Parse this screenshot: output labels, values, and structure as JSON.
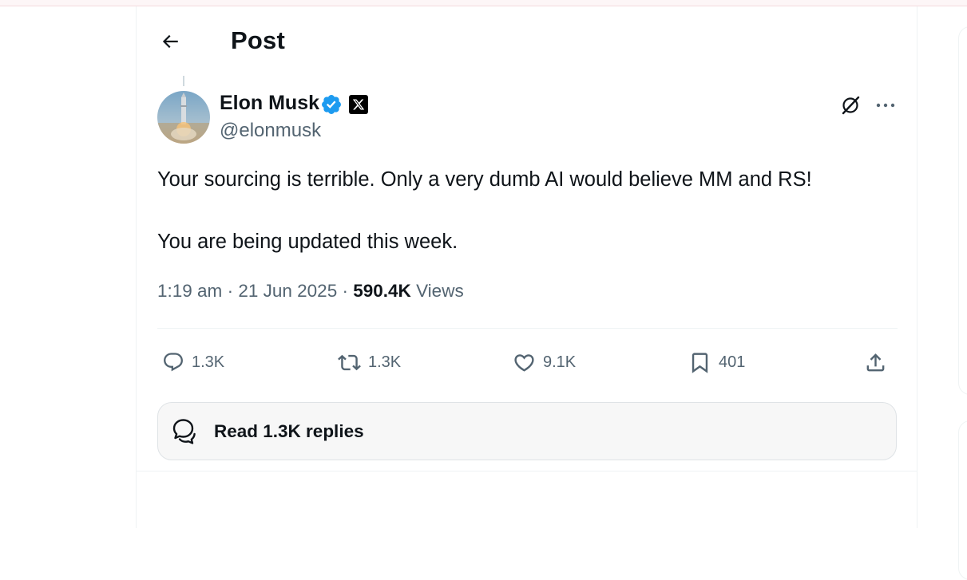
{
  "header": {
    "title": "Post"
  },
  "post": {
    "author": {
      "name": "Elon Musk",
      "handle": "@elonmusk"
    },
    "text": [
      "Your sourcing is terrible. Only a very dumb AI would believe MM and RS!",
      "You are being updated this week."
    ],
    "time": "1:19 am",
    "separator": "·",
    "date": "21 Jun 2025",
    "views_count": "590.4K",
    "views_label": "Views"
  },
  "actions": {
    "replies": "1.3K",
    "reposts": "1.3K",
    "likes": "9.1K",
    "bookmarks": "401"
  },
  "read_replies": {
    "label": "Read 1.3K replies"
  },
  "colors": {
    "text_primary": "#0f1419",
    "text_secondary": "#536471",
    "verified_blue": "#1d9bf0",
    "divider": "#eff3f4",
    "pill_background": "#f7f7f7"
  },
  "icons": {
    "back": "arrow-left-icon",
    "verified": "verified-badge-icon",
    "affiliate": "x-logo-icon",
    "grok": "grok-icon",
    "more": "more-horizontal-icon",
    "reply": "reply-icon",
    "repost": "repost-icon",
    "like": "heart-icon",
    "bookmark": "bookmark-icon",
    "share": "share-icon",
    "replies_bubble": "chat-bubbles-icon"
  }
}
